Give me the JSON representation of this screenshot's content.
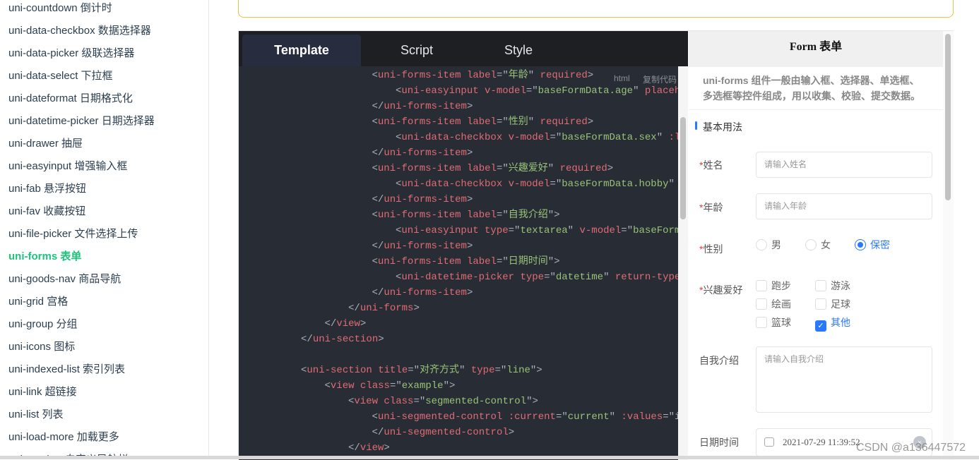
{
  "sidebar": {
    "items": [
      {
        "label": "uni-countdown 倒计时"
      },
      {
        "label": "uni-data-checkbox 数据选择器"
      },
      {
        "label": "uni-data-picker 级联选择器"
      },
      {
        "label": "uni-data-select 下拉框"
      },
      {
        "label": "uni-dateformat 日期格式化"
      },
      {
        "label": "uni-datetime-picker 日期选择器"
      },
      {
        "label": "uni-drawer 抽屉"
      },
      {
        "label": "uni-easyinput 增强输入框"
      },
      {
        "label": "uni-fab 悬浮按钮"
      },
      {
        "label": "uni-fav 收藏按钮"
      },
      {
        "label": "uni-file-picker 文件选择上传"
      },
      {
        "label": "uni-forms 表单",
        "active": true
      },
      {
        "label": "uni-goods-nav 商品导航"
      },
      {
        "label": "uni-grid 宫格"
      },
      {
        "label": "uni-group 分组"
      },
      {
        "label": "uni-icons 图标"
      },
      {
        "label": "uni-indexed-list 索引列表"
      },
      {
        "label": "uni-link 超链接"
      },
      {
        "label": "uni-list 列表"
      },
      {
        "label": "uni-load-more 加载更多"
      },
      {
        "label": "uni-nav-bar 自定义导航栏"
      }
    ],
    "active_color": "#1ec27e"
  },
  "code": {
    "tabs": [
      "Template",
      "Script",
      "Style"
    ],
    "active_tab": "Template",
    "lang": "html",
    "copy": "复制代码",
    "lines": [
      [
        3,
        [
          [
            "p",
            "<"
          ],
          [
            "t",
            "uni-forms-item"
          ],
          [
            "p",
            " "
          ],
          [
            "a",
            "label"
          ],
          [
            "p",
            "=\""
          ],
          [
            "s",
            "年龄"
          ],
          [
            "p",
            "\" "
          ],
          [
            "a",
            "required"
          ],
          [
            "p",
            ">"
          ]
        ]
      ],
      [
        4,
        [
          [
            "p",
            "<"
          ],
          [
            "t",
            "uni-easyinput"
          ],
          [
            "p",
            " "
          ],
          [
            "a",
            "v-model"
          ],
          [
            "p",
            "=\""
          ],
          [
            "s",
            "baseFormData.age"
          ],
          [
            "p",
            "\" "
          ],
          [
            "a",
            "placeholder"
          ]
        ]
      ],
      [
        3,
        [
          [
            "p",
            "</"
          ],
          [
            "t",
            "uni-forms-item"
          ],
          [
            "p",
            ">"
          ]
        ]
      ],
      [
        3,
        [
          [
            "p",
            "<"
          ],
          [
            "t",
            "uni-forms-item"
          ],
          [
            "p",
            " "
          ],
          [
            "a",
            "label"
          ],
          [
            "p",
            "=\""
          ],
          [
            "s",
            "性别"
          ],
          [
            "p",
            "\" "
          ],
          [
            "a",
            "required"
          ],
          [
            "p",
            ">"
          ]
        ]
      ],
      [
        4,
        [
          [
            "p",
            "<"
          ],
          [
            "t",
            "uni-data-checkbox"
          ],
          [
            "p",
            " "
          ],
          [
            "a",
            "v-model"
          ],
          [
            "p",
            "=\""
          ],
          [
            "s",
            "baseFormData.sex"
          ],
          [
            "p",
            "\" "
          ],
          [
            "a",
            ":localdata"
          ]
        ]
      ],
      [
        3,
        [
          [
            "p",
            "</"
          ],
          [
            "t",
            "uni-forms-item"
          ],
          [
            "p",
            ">"
          ]
        ]
      ],
      [
        3,
        [
          [
            "p",
            "<"
          ],
          [
            "t",
            "uni-forms-item"
          ],
          [
            "p",
            " "
          ],
          [
            "a",
            "label"
          ],
          [
            "p",
            "=\""
          ],
          [
            "s",
            "兴趣爱好"
          ],
          [
            "p",
            "\" "
          ],
          [
            "a",
            "required"
          ],
          [
            "p",
            ">"
          ]
        ]
      ],
      [
        4,
        [
          [
            "p",
            "<"
          ],
          [
            "t",
            "uni-data-checkbox"
          ],
          [
            "p",
            " "
          ],
          [
            "a",
            "v-model"
          ],
          [
            "p",
            "=\""
          ],
          [
            "s",
            "baseFormData.hobby"
          ],
          [
            "p",
            "\" "
          ]
        ]
      ],
      [
        3,
        [
          [
            "p",
            "</"
          ],
          [
            "t",
            "uni-forms-item"
          ],
          [
            "p",
            ">"
          ]
        ]
      ],
      [
        3,
        [
          [
            "p",
            "<"
          ],
          [
            "t",
            "uni-forms-item"
          ],
          [
            "p",
            " "
          ],
          [
            "a",
            "label"
          ],
          [
            "p",
            "=\""
          ],
          [
            "s",
            "自我介绍"
          ],
          [
            "p",
            "\">"
          ]
        ]
      ],
      [
        4,
        [
          [
            "p",
            "<"
          ],
          [
            "t",
            "uni-easyinput"
          ],
          [
            "p",
            " "
          ],
          [
            "a",
            "type"
          ],
          [
            "p",
            "=\""
          ],
          [
            "s",
            "textarea"
          ],
          [
            "p",
            "\" "
          ],
          [
            "a",
            "v-model"
          ],
          [
            "p",
            "=\""
          ],
          [
            "s",
            "baseFormData"
          ]
        ]
      ],
      [
        3,
        [
          [
            "p",
            "</"
          ],
          [
            "t",
            "uni-forms-item"
          ],
          [
            "p",
            ">"
          ]
        ]
      ],
      [
        3,
        [
          [
            "p",
            "<"
          ],
          [
            "t",
            "uni-forms-item"
          ],
          [
            "p",
            " "
          ],
          [
            "a",
            "label"
          ],
          [
            "p",
            "=\""
          ],
          [
            "s",
            "日期时间"
          ],
          [
            "p",
            "\">"
          ]
        ]
      ],
      [
        4,
        [
          [
            "p",
            "<"
          ],
          [
            "t",
            "uni-datetime-picker"
          ],
          [
            "p",
            " "
          ],
          [
            "a",
            "type"
          ],
          [
            "p",
            "=\""
          ],
          [
            "s",
            "datetime"
          ],
          [
            "p",
            "\" "
          ],
          [
            "a",
            "return-type"
          ]
        ]
      ],
      [
        3,
        [
          [
            "p",
            "</"
          ],
          [
            "t",
            "uni-forms-item"
          ],
          [
            "p",
            ">"
          ]
        ]
      ],
      [
        2,
        [
          [
            "p",
            "</"
          ],
          [
            "t",
            "uni-forms"
          ],
          [
            "p",
            ">"
          ]
        ]
      ],
      [
        1,
        [
          [
            "p",
            "</"
          ],
          [
            "t",
            "view"
          ],
          [
            "p",
            ">"
          ]
        ]
      ],
      [
        0,
        [
          [
            "p",
            "</"
          ],
          [
            "t",
            "uni-section"
          ],
          [
            "p",
            ">"
          ]
        ]
      ],
      [
        0,
        []
      ],
      [
        0,
        [
          [
            "p",
            "<"
          ],
          [
            "t",
            "uni-section"
          ],
          [
            "p",
            " "
          ],
          [
            "a",
            "title"
          ],
          [
            "p",
            "=\""
          ],
          [
            "s",
            "对齐方式"
          ],
          [
            "p",
            "\" "
          ],
          [
            "a",
            "type"
          ],
          [
            "p",
            "=\""
          ],
          [
            "s",
            "line"
          ],
          [
            "p",
            "\">"
          ]
        ]
      ],
      [
        1,
        [
          [
            "p",
            "<"
          ],
          [
            "t",
            "view"
          ],
          [
            "p",
            " "
          ],
          [
            "a",
            "class"
          ],
          [
            "p",
            "=\""
          ],
          [
            "s",
            "example"
          ],
          [
            "p",
            "\">"
          ]
        ]
      ],
      [
        2,
        [
          [
            "p",
            "<"
          ],
          [
            "t",
            "view"
          ],
          [
            "p",
            " "
          ],
          [
            "a",
            "class"
          ],
          [
            "p",
            "=\""
          ],
          [
            "s",
            "segmented-control"
          ],
          [
            "p",
            "\">"
          ]
        ]
      ],
      [
        3,
        [
          [
            "p",
            "<"
          ],
          [
            "t",
            "uni-segmented-control"
          ],
          [
            "p",
            " "
          ],
          [
            "a",
            ":current"
          ],
          [
            "p",
            "=\""
          ],
          [
            "s",
            "current"
          ],
          [
            "p",
            "\" "
          ],
          [
            "a",
            ":values"
          ],
          [
            "p",
            "=\"i"
          ]
        ]
      ],
      [
        3,
        [
          [
            "p",
            "</"
          ],
          [
            "t",
            "uni-segmented-control"
          ],
          [
            "p",
            ">"
          ]
        ]
      ],
      [
        2,
        [
          [
            "p",
            "</"
          ],
          [
            "t",
            "view"
          ],
          [
            "p",
            ">"
          ]
        ]
      ]
    ]
  },
  "preview": {
    "title": "Form 表单",
    "description": "uni-forms 组件一般由输入框、选择器、单选框、多选框等控件组成，用以收集、校验、提交数据。",
    "section": "基本用法",
    "required_mark": "*",
    "name": {
      "label": "姓名",
      "placeholder": "请输入姓名"
    },
    "age": {
      "label": "年龄",
      "placeholder": "请输入年龄"
    },
    "sex": {
      "label": "性别",
      "options": [
        "男",
        "女",
        "保密"
      ],
      "selected": "保密"
    },
    "hobby": {
      "label": "兴趣爱好",
      "options": [
        "跑步",
        "游泳",
        "绘画",
        "足球",
        "篮球",
        "其他"
      ],
      "checked": [
        "其他"
      ]
    },
    "intro": {
      "label": "自我介绍",
      "placeholder": "请输入自我介绍"
    },
    "datetime": {
      "label": "日期时间",
      "value": "2021-07-29 11:39:52"
    },
    "accent": "#2979ff"
  },
  "watermark": "CSDN @a136447572"
}
